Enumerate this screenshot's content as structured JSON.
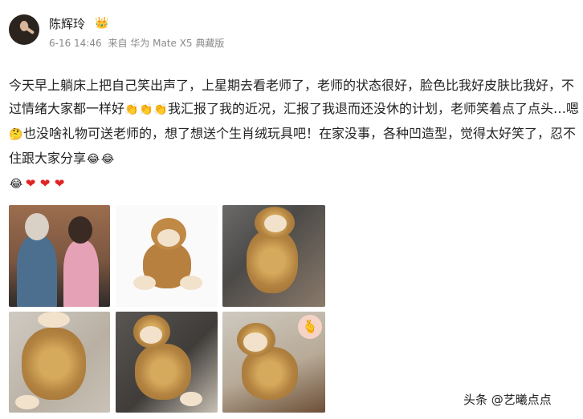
{
  "user": {
    "name": "陈辉玲",
    "badge_icon": "crown-icon"
  },
  "meta": {
    "date": "6-16 14:46",
    "source": "来自 华为 Mate X5 典藏版"
  },
  "post": {
    "text1": "今天早上躺床上把自己笑出声了，上星期去看老师了，老师的状态很好，脸色比我好皮肤比我好，不过情绪大家都一样好",
    "emoji_a": "👏",
    "emoji_b": "👏",
    "emoji_c": "👏",
    "text2": "我汇报了我的近况，汇报了我退而还没休的计划，老师笑着点了点头…嗯",
    "emoji_d": "🤔",
    "text3": "也没啥礼物可送老师的，想了想送个生肖绒玩具吧！在家没事，各种凹造型，觉得太好笑了，忍不住跟大家分享",
    "emoji_e": "😂",
    "emoji_f": "😂",
    "emoji_g": "😂",
    "hearts": [
      "❤",
      "❤",
      "❤"
    ]
  },
  "photos": [
    {
      "icon": "photo-two-people"
    },
    {
      "icon": "photo-plush-monkey"
    },
    {
      "icon": "photo-plush-monkey-sofa"
    },
    {
      "icon": "photo-plush-monkey-lying"
    },
    {
      "icon": "photo-plush-monkey-pose"
    },
    {
      "icon": "photo-plush-monkey-sticker"
    }
  ],
  "watermark": "头条 @艺曦点点"
}
